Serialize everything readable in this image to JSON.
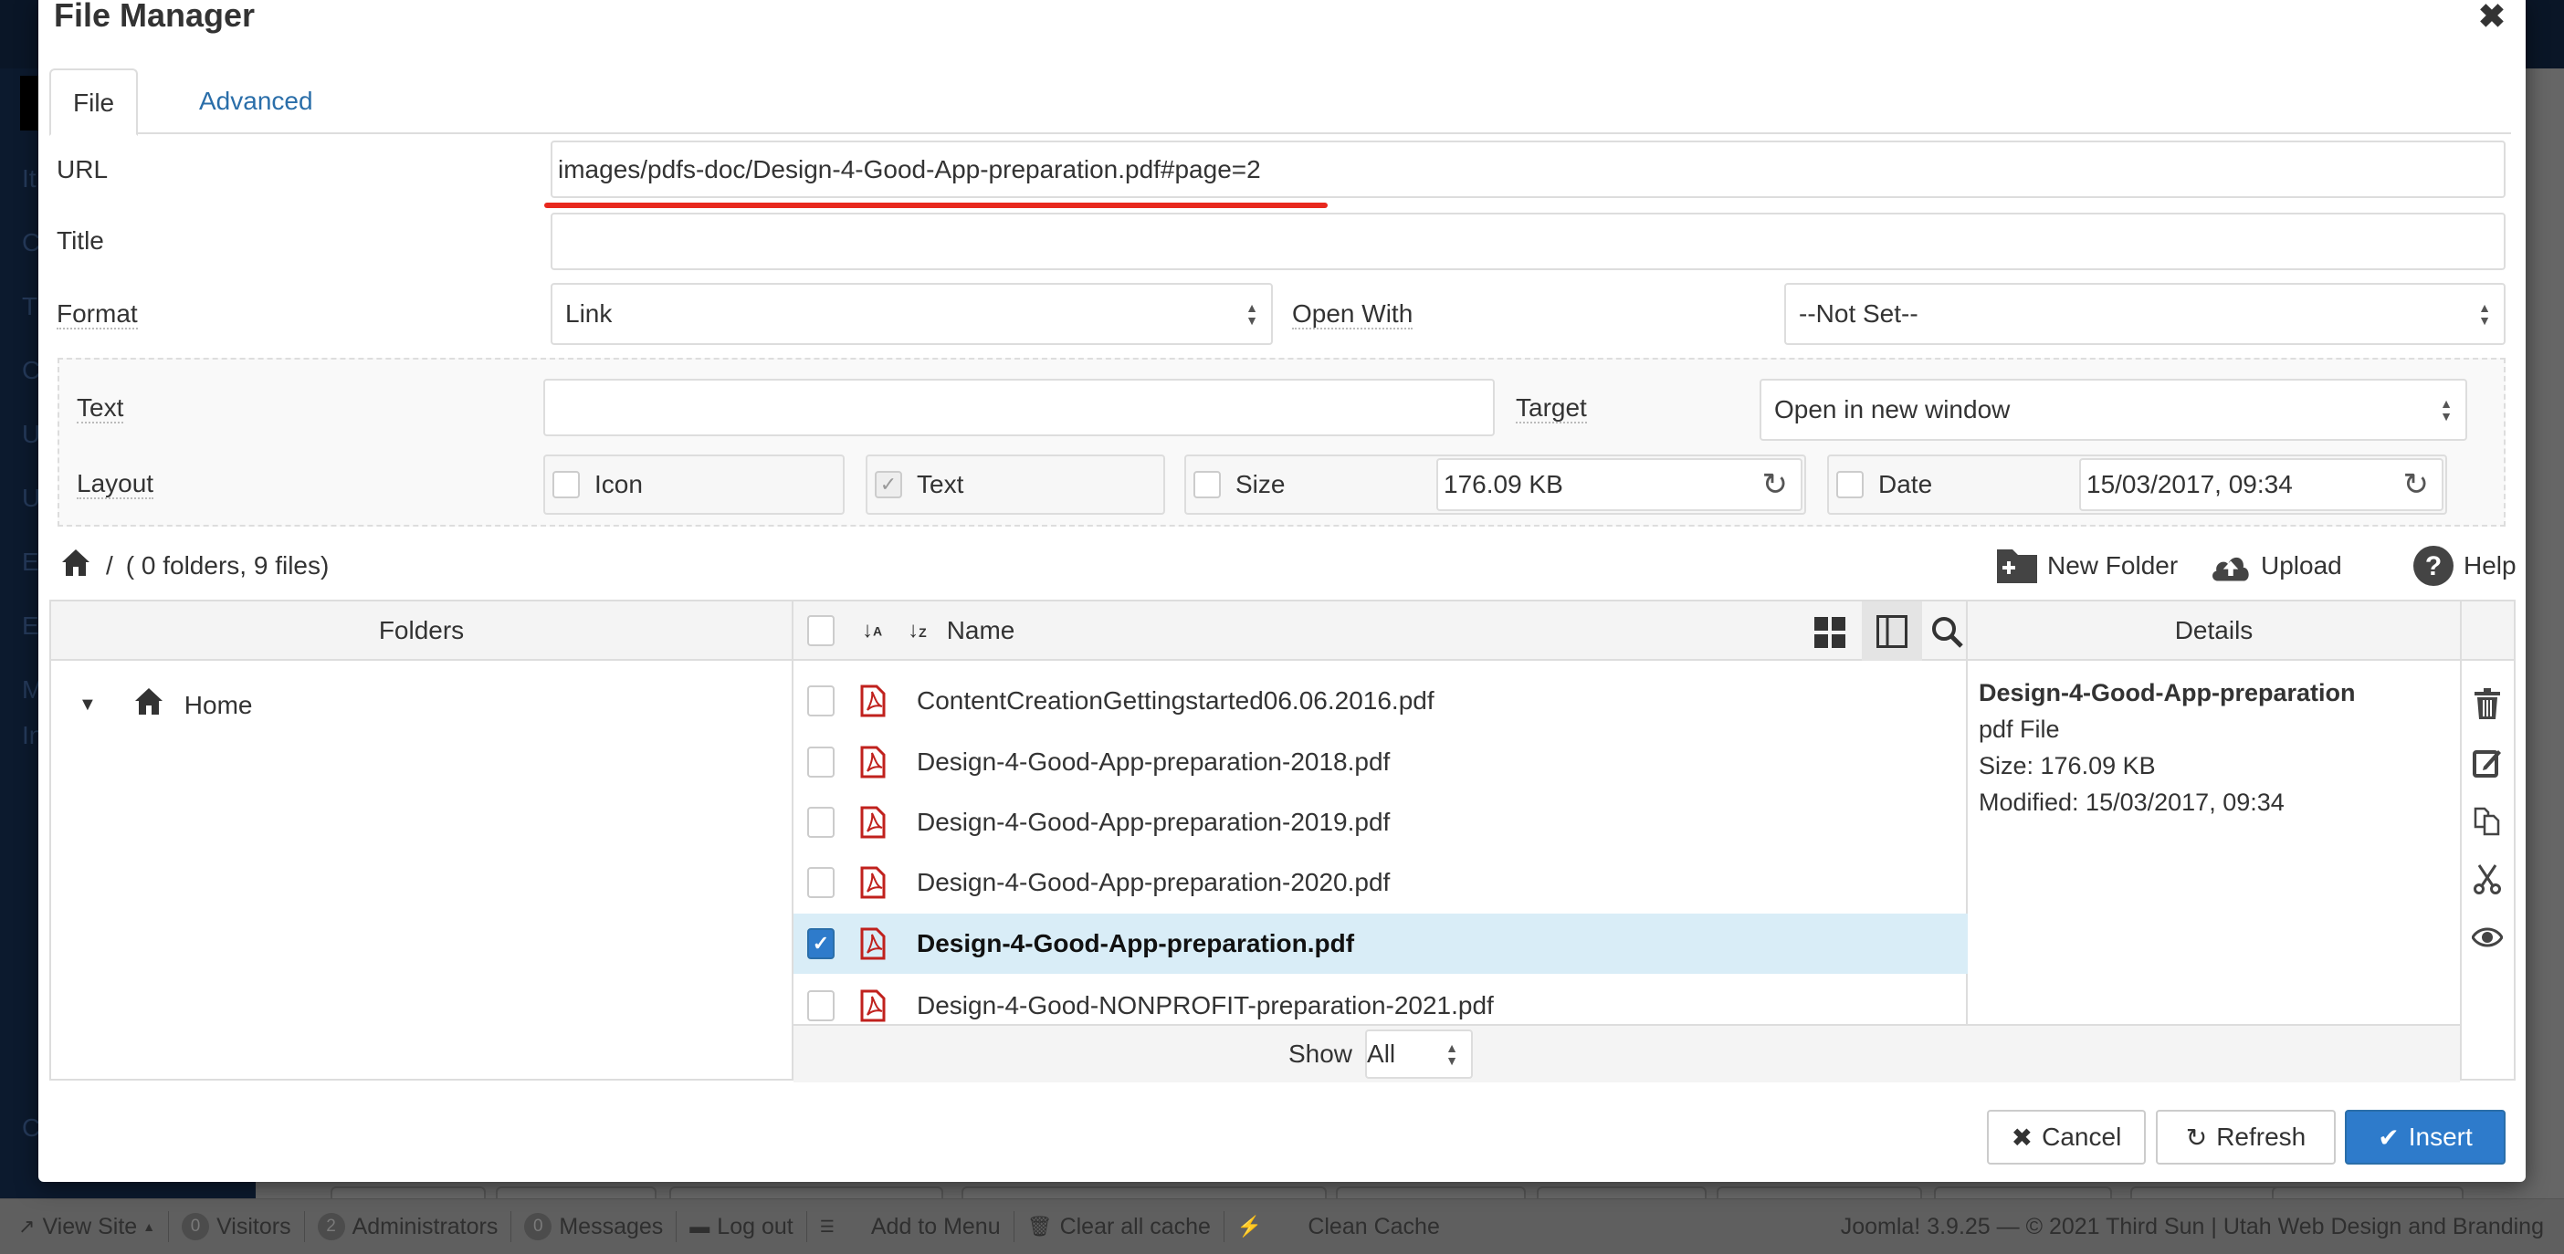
{
  "backdrop": {
    "sidebar_items": [
      "It",
      "C",
      "T",
      "C",
      "U",
      "U",
      "E",
      "E",
      "M",
      "In",
      "C"
    ]
  },
  "modal": {
    "title": "File Manager",
    "close_icon": "close-icon",
    "tabs": [
      {
        "label": "File",
        "active": true
      },
      {
        "label": "Advanced",
        "active": false
      }
    ]
  },
  "form": {
    "url": {
      "label": "URL",
      "value": "images/pdfs-doc/Design-4-Good-App-preparation.pdf#page=2"
    },
    "title": {
      "label": "Title",
      "value": ""
    },
    "format": {
      "label": "Format",
      "selected": "Link"
    },
    "open_with": {
      "label": "Open With",
      "selected": "--Not Set--"
    },
    "text": {
      "label": "Text",
      "value": ""
    },
    "target": {
      "label": "Target",
      "selected": "Open in new window"
    },
    "layout": {
      "label": "Layout",
      "icon": {
        "label": "Icon",
        "checked": false
      },
      "text": {
        "label": "Text",
        "checked": true,
        "disabled": true
      },
      "size": {
        "label": "Size",
        "checked": false,
        "value": "176.09 KB"
      },
      "date": {
        "label": "Date",
        "checked": false,
        "value": "15/03/2017, 09:34"
      }
    }
  },
  "toolbar": {
    "path": "/",
    "summary": "( 0 folders, 9 files)",
    "new_folder": "New Folder",
    "upload": "Upload",
    "help": "Help"
  },
  "browser": {
    "folders_header": "Folders",
    "name_header": "Name",
    "details_header": "Details",
    "tree": [
      {
        "label": "Home",
        "expanded": true
      }
    ],
    "files": [
      {
        "name": "ContentCreationGettingstarted06.06.2016.pdf",
        "checked": false
      },
      {
        "name": "Design-4-Good-App-preparation-2018.pdf",
        "checked": false
      },
      {
        "name": "Design-4-Good-App-preparation-2019.pdf",
        "checked": false
      },
      {
        "name": "Design-4-Good-App-preparation-2020.pdf",
        "checked": false
      },
      {
        "name": "Design-4-Good-App-preparation.pdf",
        "checked": true
      },
      {
        "name": "Design-4-Good-NONPROFIT-preparation-2021.pdf",
        "checked": false
      }
    ],
    "show_label": "Show",
    "show_value": "All",
    "details": {
      "name": "Design-4-Good-App-preparation",
      "type": "pdf File",
      "size": "Size: 176.09 KB",
      "modified": "Modified: 15/03/2017, 09:34"
    },
    "actions": [
      "trash-icon",
      "edit-icon",
      "copy-icon",
      "cut-icon",
      "preview-icon"
    ]
  },
  "buttons": {
    "cancel": "Cancel",
    "refresh": "Refresh",
    "insert": "Insert"
  },
  "statusbar": {
    "view_site": "View Site",
    "visitors_count": "0",
    "visitors": "Visitors",
    "admins_count": "2",
    "admins": "Administrators",
    "messages_count": "0",
    "messages": "Messages",
    "logout": "Log out",
    "add_to_menu": "Add to Menu",
    "clear_cache": "Clear all cache",
    "clean_cache": "Clean Cache",
    "copyright": "Joomla! 3.9.25  —  © 2021 Third Sun | Utah Web Design and Branding"
  },
  "colors": {
    "primary": "#2e7bcb",
    "link": "#2a6ea9",
    "selected_row": "#d9edf7",
    "pdf_icon": "#c0211d",
    "annotation_underline": "#e8281e"
  }
}
